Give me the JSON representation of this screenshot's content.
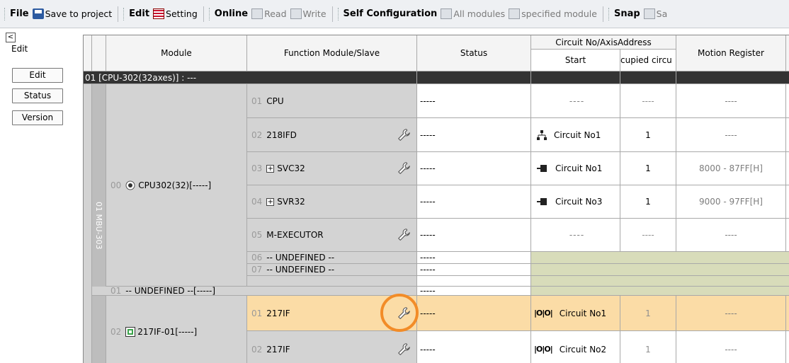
{
  "toolbar": {
    "file": {
      "title": "File",
      "save": "Save to project"
    },
    "edit": {
      "title": "Edit",
      "setting": "Setting"
    },
    "online": {
      "title": "Online",
      "read": "Read",
      "write": "Write"
    },
    "selfconf": {
      "title": "Self Configuration",
      "all": "All modules",
      "specified": "specified module"
    },
    "snap": {
      "title": "Snap",
      "trail": "Sa"
    }
  },
  "left_panel": {
    "collapse": "<",
    "title": "Edit",
    "buttons": [
      "Edit",
      "Status",
      "Version"
    ]
  },
  "columns": {
    "module": "Module",
    "function": "Function Module/Slave",
    "status": "Status",
    "circuit": "Circuit No/AxisAddress",
    "start": "Start",
    "occupied": "cupied circu",
    "motion": "Motion Register"
  },
  "group_row": "01 [CPU-302(32axes)] : ---",
  "rack": "01 MBU-303",
  "module_cpu": {
    "num": "00",
    "name": "CPU302(32)[-----]"
  },
  "module_undef": {
    "num": "01",
    "name": "-- UNDEFINED --[-----]",
    "status": "-----"
  },
  "module_217": {
    "num": "02",
    "name": "217IF-01[-----]"
  },
  "rows": [
    {
      "num": "01",
      "name": "CPU",
      "status": "-----",
      "start": "----",
      "occupied": "----",
      "motion": "----"
    },
    {
      "num": "02",
      "name": "218IFD",
      "status": "-----",
      "start": "Circuit No1",
      "occupied": "1",
      "motion": "----"
    },
    {
      "num": "03",
      "name": "SVC32",
      "status": "-----",
      "start": "Circuit No1",
      "occupied": "1",
      "motion": "8000 - 87FF[H]"
    },
    {
      "num": "04",
      "name": "SVR32",
      "status": "-----",
      "start": "Circuit No3",
      "occupied": "1",
      "motion": "9000 - 97FF[H]"
    },
    {
      "num": "05",
      "name": "M-EXECUTOR",
      "status": "-----",
      "start": "----",
      "occupied": "----",
      "motion": "----"
    },
    {
      "num": "06",
      "name": "-- UNDEFINED --",
      "status": "-----"
    },
    {
      "num": "07",
      "name": "-- UNDEFINED --",
      "status": "-----"
    },
    {
      "num": "01",
      "name": "217IF",
      "status": "-----",
      "start": "Circuit No1",
      "occupied": "1",
      "motion": "----"
    },
    {
      "num": "02",
      "name": "217IF",
      "status": "-----",
      "start": "Circuit No2",
      "occupied": "1",
      "motion": "----"
    }
  ],
  "colors": {
    "selected_row": "#fbdca6",
    "highlight_ring": "#f28c28",
    "undefined_fill": "#d8dcba"
  }
}
